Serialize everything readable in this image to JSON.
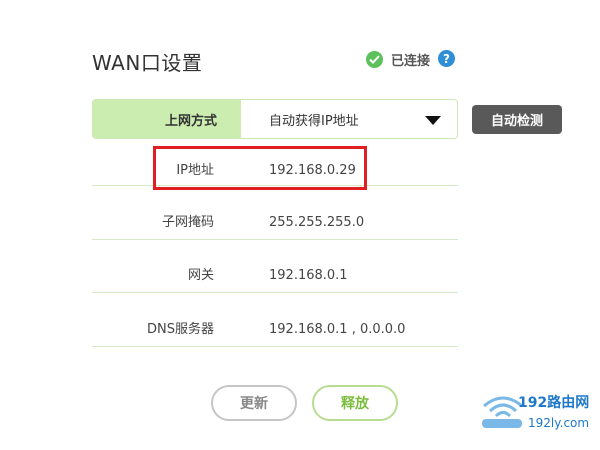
{
  "header": {
    "title": "WAN口设置",
    "status_text": "已连接",
    "help_symbol": "?"
  },
  "connection": {
    "label": "上网方式",
    "selected": "自动获得IP地址",
    "detect_label": "自动检测"
  },
  "rows": [
    {
      "label": "IP地址",
      "value": "192.168.0.29"
    },
    {
      "label": "子网掩码",
      "value": "255.255.255.0"
    },
    {
      "label": "网关",
      "value": "192.168.0.1"
    },
    {
      "label": "DNS服务器",
      "value": "192.168.0.1 , 0.0.0.0"
    }
  ],
  "actions": {
    "refresh_label": "更新",
    "release_label": "释放"
  },
  "watermark": {
    "title": "192路由网",
    "url": "192ly.com"
  },
  "colors": {
    "accent_green": "#7cbd3f",
    "label_bg": "#ccedb0",
    "highlight_red": "#e02020",
    "help_blue": "#2f8fd6"
  },
  "icons": {
    "status": "check-circle-icon",
    "help": "question-icon",
    "dropdown": "caret-down-icon",
    "watermark": "wifi-icon"
  }
}
